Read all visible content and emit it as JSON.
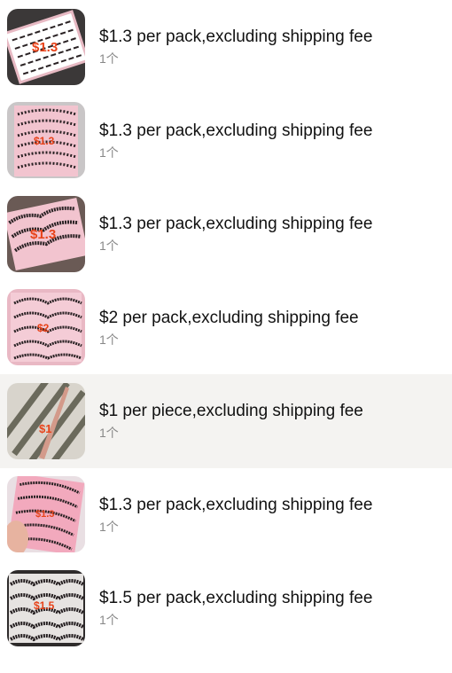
{
  "items": [
    {
      "title": "$1.3 per pack,excluding shipping fee",
      "qty": "1个",
      "price_tag": "$1.3",
      "thumb": "lash-box-icon"
    },
    {
      "title": "$1.3 per pack,excluding shipping fee",
      "qty": "1个",
      "price_tag": "$1.3",
      "thumb": "lash-strips-pink-icon"
    },
    {
      "title": "$1.3 per pack,excluding shipping fee",
      "qty": "1个",
      "price_tag": "$1.3",
      "thumb": "lash-tray-pink-icon"
    },
    {
      "title": "$2 per pack,excluding shipping fee",
      "qty": "1个",
      "price_tag": "$2",
      "thumb": "lash-tray-pink-icon"
    },
    {
      "title": "$1 per piece,excluding shipping fee",
      "qty": "1个",
      "price_tag": "$1",
      "thumb": "tweezers-icon"
    },
    {
      "title": "$1.3 per pack,excluding shipping fee",
      "qty": "1个",
      "price_tag": "$1.3",
      "thumb": "lash-tray-hand-icon"
    },
    {
      "title": "$1.5 per pack,excluding shipping fee",
      "qty": "1个",
      "price_tag": "$1.5",
      "thumb": "lash-tray-dark-icon"
    }
  ],
  "highlighted_index": 4,
  "colors": {
    "price_tag": "#e8431a",
    "tray_pink": "#f2c4cf",
    "lash": "#2a2224"
  }
}
